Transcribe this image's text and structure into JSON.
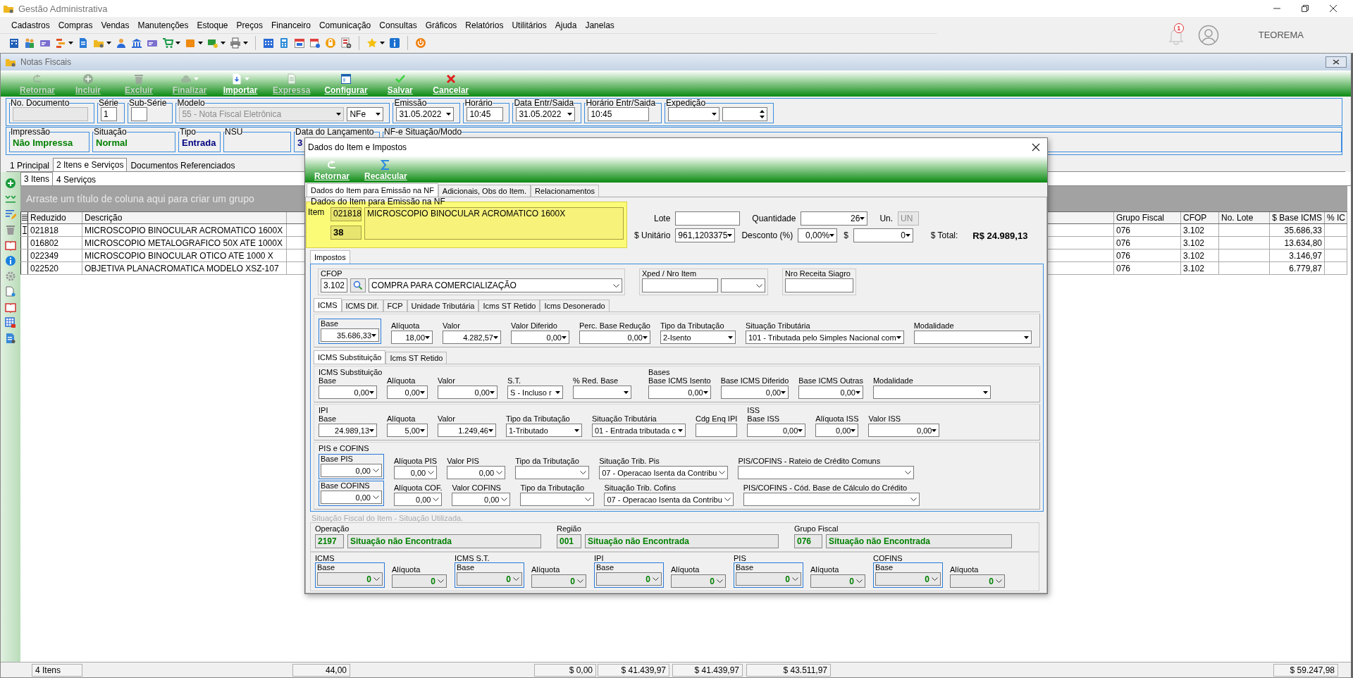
{
  "app": {
    "title": "Gestão Administrativa",
    "notification_count": "1",
    "user": "TEOREMA"
  },
  "menu": [
    "Cadastros",
    "Compras",
    "Vendas",
    "Manutenções",
    "Estoque",
    "Preços",
    "Financeiro",
    "Comunicação",
    "Consultas",
    "Gráficos",
    "Relatórios",
    "Utilitários",
    "Ajuda",
    "Janelas"
  ],
  "notas": {
    "title": "Notas Fiscais",
    "actions": [
      {
        "label": "Retornar",
        "disabled": true,
        "dropdown": false
      },
      {
        "label": "Incluir",
        "disabled": true,
        "dropdown": false
      },
      {
        "label": "Excluir",
        "disabled": true,
        "dropdown": false
      },
      {
        "label": "Finalizar",
        "disabled": true,
        "dropdown": true
      },
      {
        "label": "Importar",
        "disabled": false,
        "dropdown": true
      },
      {
        "label": "Expressa",
        "disabled": true,
        "dropdown": false
      },
      {
        "label": "Configurar",
        "disabled": false,
        "dropdown": false
      },
      {
        "label": "Salvar",
        "disabled": false,
        "dropdown": false
      },
      {
        "label": "Cancelar",
        "disabled": false,
        "dropdown": false
      }
    ],
    "row1": [
      {
        "label": "No. Documento",
        "controls": [
          {
            "kind": "text",
            "disabled": true
          }
        ]
      },
      {
        "label": "Série",
        "controls": [
          {
            "kind": "text",
            "value": "1",
            "disabled": false
          }
        ]
      },
      {
        "label": "Sub-Série",
        "controls": [
          {
            "kind": "text",
            "disabled": false
          }
        ]
      },
      {
        "label": "Modelo",
        "controls": [
          {
            "kind": "combo",
            "value": "55 - Nota Fiscal Eletrônica",
            "disabled": true
          },
          {
            "kind": "combo",
            "value": "NFe",
            "disabled": false
          }
        ]
      },
      {
        "label": "Emissão",
        "controls": [
          {
            "kind": "combo",
            "value": "31.05.2022",
            "disabled": false
          }
        ]
      },
      {
        "label": "Horário",
        "controls": [
          {
            "kind": "text",
            "value": "10:45",
            "disabled": false
          }
        ]
      },
      {
        "label": "Data Entr/Saida",
        "controls": [
          {
            "kind": "combo",
            "value": "31.05.2022",
            "disabled": false
          }
        ]
      },
      {
        "label": "Horário Entr/Saida",
        "controls": [
          {
            "kind": "text",
            "value": "10:45",
            "disabled": false
          }
        ]
      },
      {
        "label": "Expedição",
        "controls": [
          {
            "kind": "combo",
            "disabled": false
          },
          {
            "kind": "spin",
            "disabled": false
          }
        ]
      }
    ],
    "row2": [
      {
        "label": "Impressão",
        "value": "Não Impressa",
        "color": "#008000"
      },
      {
        "label": "Situação",
        "value": "Normal",
        "color": "#008000"
      },
      {
        "label": "Tipo",
        "value": "Entrada",
        "color": "#000080"
      },
      {
        "label": "NSU"
      },
      {
        "label": "Data do Lançamento",
        "value": "3",
        "color": "#000080"
      },
      {
        "label": "NF-e Situação/Modo"
      }
    ],
    "tabs": [
      {
        "label": "1 Principal",
        "selected": false
      },
      {
        "label": "2 Itens e Serviços",
        "selected": true
      },
      {
        "label": "Documentos Referenciados",
        "selected": false
      }
    ],
    "subtabs": [
      {
        "label": "3 Itens",
        "selected": true
      },
      {
        "label": "4 Serviços",
        "selected": false
      }
    ],
    "group_hint": "Arraste um título de coluna aqui para criar um grupo",
    "columns_left": [
      "Reduzido",
      "Descrição"
    ],
    "columns_right": [
      "Grupo Fiscal",
      "CFOP",
      "No. Lote",
      "$ Base ICMS",
      "% IC"
    ],
    "rows": [
      {
        "selected": true,
        "reduzido": "021818",
        "descricao": "MICROSCOPIO BINOCULAR ACROMATICO 1600X",
        "grupo_fiscal": "076",
        "cfop": "3.102",
        "base_icms": "35.686,33"
      },
      {
        "selected": false,
        "reduzido": "016802",
        "descricao": "MICROSCOPIO METALOGRAFICO 50X ATE 1000X",
        "grupo_fiscal": "076",
        "cfop": "3.102",
        "base_icms": "13.634,80"
      },
      {
        "selected": false,
        "reduzido": "022349",
        "descricao": "MICROSCOPIO BINOCULAR OTICO ATE 1000 X",
        "grupo_fiscal": "076",
        "cfop": "3.102",
        "base_icms": "3.146,97"
      },
      {
        "selected": false,
        "reduzido": "022520",
        "descricao": "OBJETIVA PLANACROMATICA MODELO XSZ-107",
        "grupo_fiscal": "076",
        "cfop": "3.102",
        "base_icms": "6.779,87"
      }
    ],
    "status_bar": [
      "4 Itens",
      "44,00",
      "$ 0,00",
      "$ 41.439,97",
      "$ 41.439,97",
      "$ 43.511,97",
      "$ 59.247,98"
    ]
  },
  "dialog": {
    "title": "Dados do Item e Impostos",
    "actions": [
      "Retornar",
      "Recalcular"
    ],
    "tabs": [
      {
        "label": "Dados do Item para Emissão na NF",
        "selected": true
      },
      {
        "label": "Adicionais, Obs do Item.",
        "selected": false
      },
      {
        "label": "Relacionamentos",
        "selected": false
      }
    ],
    "item": {
      "group": "Dados do Item para Emissão na NF",
      "label": "Item",
      "code": "021818",
      "number": "38",
      "description": "MICROSCOPIO BINOCULAR ACROMATICO 1600X"
    },
    "item_fields_1": [
      {
        "label": "Lote",
        "kind": "text",
        "disabled": false
      },
      {
        "label": "Quantidade",
        "kind": "number",
        "value": "26",
        "disabled": false
      },
      {
        "label": "Un.",
        "kind": "text",
        "value": "UN",
        "disabled": true
      }
    ],
    "item_fields_2": [
      {
        "label": "$ Unitário",
        "kind": "number",
        "value": "961,1203375"
      },
      {
        "label": "Desconto (%)",
        "kind": "number",
        "value": "0,00%"
      },
      {
        "label": "$",
        "kind": "number",
        "value": "0"
      }
    ],
    "total": {
      "label": "$ Total:",
      "value": "R$ 24.989,13"
    },
    "impostos_tab": "Impostos",
    "cfop": {
      "label": "CFOP",
      "code": "3.102",
      "description": "COMPRA PARA COMERCIALIZAÇÃO"
    },
    "xped": {
      "label": "Xped / Nro Item"
    },
    "receita": {
      "label": "Nro Receita Siagro"
    },
    "icms_tabs": [
      {
        "label": "ICMS",
        "selected": true
      },
      {
        "label": "ICMS Dif.",
        "selected": false
      },
      {
        "label": "FCP",
        "selected": false
      },
      {
        "label": "Unidade Tributária",
        "selected": false
      },
      {
        "label": "Icms ST Retido",
        "selected": false
      },
      {
        "label": "Icms Desonerado",
        "selected": false
      }
    ],
    "icms": [
      {
        "label": "Base",
        "kind": "number",
        "value": "35.686,33",
        "framed": true
      },
      {
        "label": "Alíquota",
        "kind": "number",
        "value": "18,00",
        "framed": false
      },
      {
        "label": "Valor",
        "kind": "number",
        "value": "4.282,57",
        "framed": false
      },
      {
        "label": "Valor Diferido",
        "kind": "number",
        "value": "0,00",
        "framed": false
      },
      {
        "label": "Perc. Base Redução",
        "kind": "number",
        "value": "0,00",
        "framed": false
      },
      {
        "label": "Tipo da Tributação",
        "kind": "combo",
        "value": "2-Isento",
        "framed": false
      },
      {
        "label": "Situação Tributária",
        "kind": "combo",
        "value": "101 - Tributada pelo Simples Nacional com",
        "framed": false
      },
      {
        "label": "Modalidade",
        "kind": "combo",
        "framed": false
      }
    ],
    "st_tabs": [
      {
        "label": "ICMS Substituição",
        "selected": true
      },
      {
        "label": "Icms ST Retido",
        "selected": false
      }
    ],
    "st_group": {
      "title": "ICMS Substituição",
      "fields": [
        {
          "label": "Base",
          "kind": "number",
          "value": "0,00"
        },
        {
          "label": "Alíquota",
          "kind": "number",
          "value": "0,00"
        },
        {
          "label": "Valor",
          "kind": "number",
          "value": "0,00"
        },
        {
          "label": "S.T.",
          "kind": "combo",
          "value": "S - Incluso r"
        },
        {
          "label": "% Red. Base",
          "kind": "combo"
        }
      ]
    },
    "bases_group": {
      "title": "Bases",
      "fields": [
        {
          "label": "Base ICMS Isento",
          "kind": "number",
          "value": "0,00"
        },
        {
          "label": "Base ICMS Diferido",
          "kind": "number",
          "value": "0,00"
        },
        {
          "label": "Base ICMS Outras",
          "kind": "number",
          "value": "0,00"
        },
        {
          "label": "Modalidade",
          "kind": "combo"
        }
      ]
    },
    "ipi_group": {
      "title": "IPI",
      "fields": [
        {
          "label": "Base",
          "kind": "number",
          "value": "24.989,13"
        },
        {
          "label": "Alíquota",
          "kind": "number",
          "value": "5,00"
        },
        {
          "label": "Valor",
          "kind": "number",
          "value": "1.249,46"
        },
        {
          "label": "Tipo da Tributação",
          "kind": "combo",
          "value": "1-Tributado"
        },
        {
          "label": "Situação Tributária",
          "kind": "combo",
          "value": "01 - Entrada tributada c"
        },
        {
          "label": "Cdg Enq IPI",
          "kind": "text"
        }
      ]
    },
    "iss_group": {
      "title": "ISS",
      "fields": [
        {
          "label": "Base ISS",
          "kind": "number",
          "value": "0,00"
        },
        {
          "label": "Alíquota ISS",
          "kind": "number",
          "value": "0,00"
        },
        {
          "label": "Valor ISS",
          "kind": "number",
          "value": "0,00"
        }
      ]
    },
    "pis_cofins": {
      "title": "PIS e COFINS",
      "rows": [
        [
          {
            "label": "Base PIS",
            "kind": "amount",
            "value": "0,00",
            "framed": true
          },
          {
            "label": "Alíquota PIS",
            "kind": "amount",
            "value": "0,00",
            "framed": false
          },
          {
            "label": "Valor PIS",
            "kind": "amount",
            "value": "0,00",
            "framed": false
          },
          {
            "label": "Tipo da Tributação",
            "kind": "select",
            "framed": false
          },
          {
            "label": "Situação Trib. Pis",
            "kind": "select",
            "value": "07 - Operacao Isenta da Contribu",
            "framed": false
          },
          {
            "label": "PIS/COFINS - Rateio de Crédito Comuns",
            "kind": "select",
            "framed": false
          }
        ],
        [
          {
            "label": "Base COFINS",
            "kind": "amount",
            "value": "0,00",
            "framed": true
          },
          {
            "label": "Alíquota COF.",
            "kind": "amount",
            "value": "0,00",
            "framed": false
          },
          {
            "label": "Valor COFINS",
            "kind": "amount",
            "value": "0,00",
            "framed": false
          },
          {
            "label": "Tipo da Tributação",
            "kind": "select",
            "framed": false
          },
          {
            "label": "Situação Trib. Cofins",
            "kind": "select",
            "value": "07 - Operacao Isenta da Contribu",
            "framed": false
          },
          {
            "label": "PIS/COFINS - Cód. Base de Cálculo do Crédito",
            "kind": "select",
            "framed": false
          }
        ]
      ]
    },
    "situacao": {
      "title": "Situação Fiscal do Item - Situação Utilizada.",
      "parts": [
        {
          "label": "Operação",
          "code": "2197",
          "description": "Situação não Encontrada"
        },
        {
          "label": "Região",
          "code": "001",
          "description": "Situação não Encontrada"
        },
        {
          "label": "Grupo Fiscal",
          "code": "076",
          "description": "Situação não Encontrada"
        }
      ]
    },
    "tax_summary": [
      {
        "title": "ICMS",
        "fields": [
          {
            "label": "Base",
            "kind": "amount",
            "value": "0",
            "framed": true
          },
          {
            "label": "Alíquota",
            "kind": "amount",
            "value": "0",
            "framed": false
          }
        ]
      },
      {
        "title": "ICMS S.T.",
        "fields": [
          {
            "label": "Base",
            "kind": "amount",
            "value": "0",
            "framed": true
          },
          {
            "label": "Alíquota",
            "kind": "amount",
            "value": "0",
            "framed": false
          }
        ]
      },
      {
        "title": "IPI",
        "fields": [
          {
            "label": "Base",
            "kind": "amount",
            "value": "0",
            "framed": true
          },
          {
            "label": "Alíquota",
            "kind": "amount",
            "value": "0",
            "framed": false
          }
        ]
      },
      {
        "title": "PIS",
        "fields": [
          {
            "label": "Base",
            "kind": "amount",
            "value": "0",
            "framed": true
          },
          {
            "label": "Alíquota",
            "kind": "amount",
            "value": "0",
            "framed": false
          }
        ]
      },
      {
        "title": "COFINS",
        "fields": [
          {
            "label": "Base",
            "kind": "amount",
            "value": "0",
            "framed": true
          },
          {
            "label": "Alíquota",
            "kind": "amount",
            "value": "0",
            "framed": false
          }
        ]
      }
    ]
  }
}
